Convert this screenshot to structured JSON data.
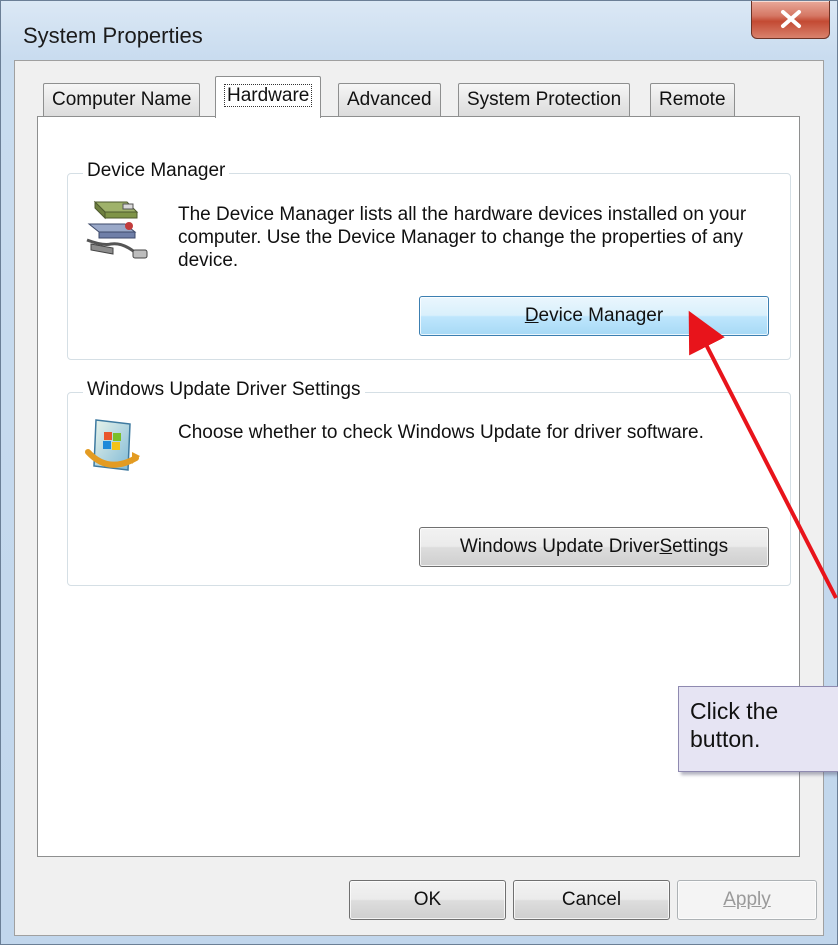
{
  "window": {
    "title": "System Properties"
  },
  "tabs": [
    {
      "label": "Computer Name",
      "active": false
    },
    {
      "label": "Hardware",
      "active": true
    },
    {
      "label": "Advanced",
      "active": false
    },
    {
      "label": "System Protection",
      "active": false
    },
    {
      "label": "Remote",
      "active": false
    }
  ],
  "device_manager": {
    "group_title": "Device Manager",
    "description": "The Device Manager lists all the hardware devices installed on your computer. Use the Device Manager to change the properties of any device.",
    "button_label_pre": "",
    "button_label_accel": "D",
    "button_label_post": "evice Manager"
  },
  "windows_update": {
    "group_title": "Windows Update Driver Settings",
    "description": "Choose whether to check Windows Update for driver software.",
    "button_label_pre": "Windows Update Driver ",
    "button_label_accel": "S",
    "button_label_post": "ettings"
  },
  "footer": {
    "ok_label": "OK",
    "cancel_label": "Cancel",
    "apply_label": "Apply"
  },
  "callout": {
    "text": "Click the button."
  },
  "colors": {
    "arrow": "#e8141b",
    "close_button": "#c34a33",
    "hot_button_border": "#3c7fb1"
  },
  "icons": [
    "close-icon",
    "device-manager-icon",
    "windows-update-icon"
  ]
}
